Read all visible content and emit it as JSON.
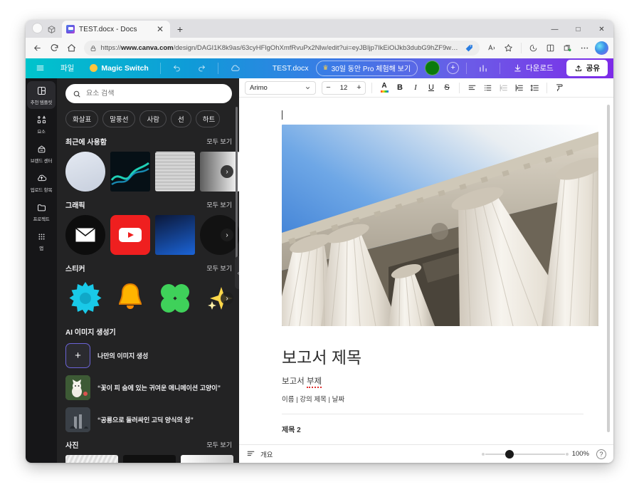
{
  "window": {
    "controls": {
      "minimize": "—",
      "maximize": "□",
      "close": "✕"
    }
  },
  "browser": {
    "tab": {
      "title": "TEST.docx - Docs",
      "close_label": "✕",
      "favicon_name": "docs-favicon"
    },
    "new_tab_label": "+",
    "nav": {
      "back": "←",
      "reload": "⟳",
      "home": "⌂"
    },
    "omnibox": {
      "lock_icon": "site-info-icon",
      "url_prefix": "https://",
      "url_domain": "www.canva.com",
      "url_path": "/design/DAGI1K8k9as/63cyHFlgOhXmfRvuPx2Nlw/edit?ui=eyJBIjp7IkEiOiJkb3dubG9hZF9wZGZjRkliwiRil…"
    },
    "toolbar_icons": [
      "price-tag-icon",
      "read-aloud-icon",
      "favorite-star-icon",
      "history-icon",
      "split-screen-icon",
      "collections-icon",
      "more-options-icon",
      "copilot-icon"
    ]
  },
  "canva": {
    "topbar": {
      "menu_label": "☰",
      "file_label": "파일",
      "magic_switch_label": "Magic Switch",
      "undo_label": "undo-icon",
      "redo_label": "redo-icon",
      "cloud_label": "cloud-saved-icon",
      "doc_name": "TEST.docx",
      "pro_trial_label": "30일 동안 Pro 체험해 보기",
      "crown": "♛",
      "plus_label": "+",
      "insights_label": "insights-icon",
      "download_label": "다운로드",
      "share_label": "공유",
      "accent_start": "#00c4cc",
      "accent_end": "#7d2ae8"
    },
    "rail": [
      {
        "label": "추천 템플릿",
        "icon": "templates-icon",
        "active": true
      },
      {
        "label": "요소",
        "icon": "elements-icon",
        "active": false
      },
      {
        "label": "브랜드 센터",
        "icon": "brand-center-icon",
        "active": false
      },
      {
        "label": "업로드 항목",
        "icon": "uploads-icon",
        "active": false
      },
      {
        "label": "프로젝트",
        "icon": "projects-icon",
        "active": false
      },
      {
        "label": "앱",
        "icon": "apps-icon",
        "active": false
      }
    ],
    "panel": {
      "search_placeholder": "요소 검색",
      "chips": [
        "화살표",
        "말풍선",
        "사람",
        "선",
        "하트"
      ],
      "see_all": "모두 보기",
      "sections": {
        "recent": "최근에 사용함",
        "graphics": "그래픽",
        "stickers": "스티커",
        "ai": "AI 이미지 생성기",
        "photos": "사진"
      },
      "ai_create_label": "나만의 이미지 생성",
      "ai_prompts": [
        "“꽃이 피 숨에 있는 귀여운 애니메이션 고양이”",
        "“공룡으로 둘러싸인 고딕 양식의 성”"
      ],
      "next_arrow": "›",
      "collapse_arrow": "‹"
    },
    "format_toolbar": {
      "font_family": "Arimo",
      "font_size": "12",
      "minus": "−",
      "plus": "+",
      "chevron": "⌄",
      "bold": "B",
      "italic": "I",
      "underline": "U",
      "strike": "S",
      "text_color": "A",
      "icons": [
        "align-left-icon",
        "bullet-list-icon",
        "outdent-icon",
        "indent-icon",
        "line-spacing-icon",
        "format-painter-icon"
      ]
    },
    "document": {
      "image_alt": "classical-columns-photo",
      "title": "보고서 제목",
      "subtitle_prefix": "보고서 ",
      "subtitle_misspelled": "부제",
      "meta": "이름 | 강의 제목 | 날짜",
      "heading2": "제목 2"
    },
    "statusbar": {
      "outline_label": "개요",
      "zoom_value": "100%",
      "help_label": "?"
    }
  }
}
